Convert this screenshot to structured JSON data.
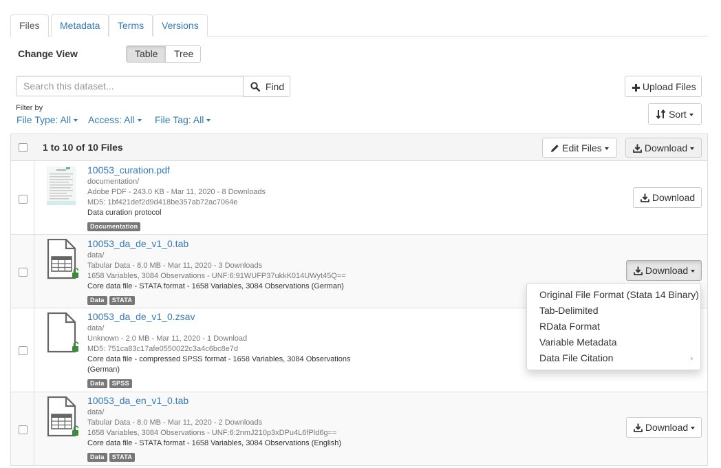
{
  "tabs": [
    {
      "label": "Files",
      "active": true
    },
    {
      "label": "Metadata",
      "active": false
    },
    {
      "label": "Terms",
      "active": false
    },
    {
      "label": "Versions",
      "active": false
    }
  ],
  "change_view": {
    "label": "Change View",
    "options": [
      "Table",
      "Tree"
    ],
    "selected": "Table"
  },
  "search": {
    "placeholder": "Search this dataset...",
    "button_label": "Find",
    "button_icon": "search-icon"
  },
  "upload": {
    "label": "Upload Files",
    "icon": "plus-icon"
  },
  "filters": {
    "label": "Filter by",
    "items": [
      "File Type: All",
      "Access: All",
      "File Tag: All"
    ]
  },
  "sort": {
    "label": "Sort",
    "icon": "sort-icon"
  },
  "table": {
    "count_label": "1 to 10 of 10 Files",
    "edit_label": "Edit Files",
    "download_label": "Download"
  },
  "files": [
    {
      "name": "10053_curation.pdf",
      "folder": "documentation/",
      "info": "Adobe PDF - 243.0 KB - Mar 11, 2020 - 8 Downloads",
      "checksum": "MD5: 1bf421def2d9d418be357ab72ac7064e",
      "description": "Data curation protocol",
      "tags": [
        "Documentation"
      ],
      "icon": "pdf-thumbnail",
      "download_label": "Download"
    },
    {
      "name": "10053_da_de_v1_0.tab",
      "folder": "data/",
      "info": "Tabular Data - 8.0 MB - Mar 11, 2020 - 3 Downloads",
      "checksum": "1658 Variables, 3084 Observations - UNF:6:91WUFP37ukkK014UWyt45Q==",
      "description": "Core data file - STATA format - 1658 Variables, 3084 Observations (German)",
      "tags": [
        "Data",
        "STATA"
      ],
      "icon": "tabular-file-icon",
      "download_label": "Download"
    },
    {
      "name": "10053_da_de_v1_0.zsav",
      "folder": "data/",
      "info": "Unknown - 2.0 MB - Mar 11, 2020 - 1 Download",
      "checksum": "MD5: 751ca83c17afe0550022c3a4c6bc8e7d",
      "description": "Core data file - compressed SPSS format - 1658 Variables, 3084 Observations",
      "description2": "(German)",
      "tags": [
        "Data",
        "SPSS"
      ],
      "icon": "generic-file-icon"
    },
    {
      "name": "10053_da_en_v1_0.tab",
      "folder": "data/",
      "info": "Tabular Data - 8.0 MB - Mar 11, 2020 - 2 Downloads",
      "checksum": "1658 Variables, 3084 Observations - UNF:6:2nmJ210p3xDPu4L6fPld6g==",
      "description": "Core data file - STATA format - 1658 Variables, 3084 Observations (English)",
      "tags": [
        "Data",
        "STATA"
      ],
      "icon": "tabular-file-icon",
      "download_label": "Download"
    }
  ],
  "download_menu": [
    "Original File Format (Stata 14 Binary)",
    "Tab-Delimited",
    "RData Format",
    "Variable Metadata",
    "Data File Citation"
  ],
  "colors": {
    "link": "#337ab7",
    "unlock": "#3c8b3c",
    "tag": "#777777"
  }
}
